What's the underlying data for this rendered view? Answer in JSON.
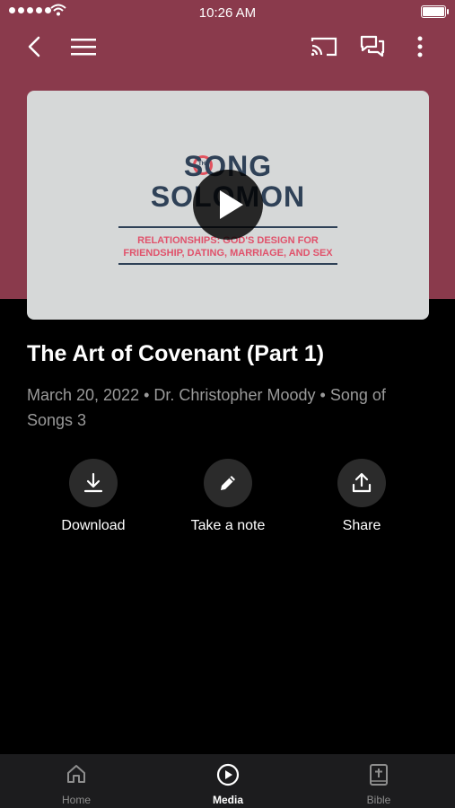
{
  "status_bar": {
    "time": "10:26 AM"
  },
  "media": {
    "artwork": {
      "title_line1": "SONG",
      "title_line2": "SOLOMON",
      "the_label": "THE",
      "subtitle_line1": "RELATIONSHIPS: GOD'S DESIGN FOR",
      "subtitle_line2": "FRIENDSHIP, DATING, MARRIAGE, AND SEX"
    },
    "title": "The Art of Covenant (Part 1)",
    "date": "March 20, 2022",
    "speaker": "Dr. Christopher Moody",
    "series": "Song of Songs 3"
  },
  "actions": [
    {
      "label": "Download",
      "icon": "download-icon"
    },
    {
      "label": "Take a note",
      "icon": "pencil-icon"
    },
    {
      "label": "Share",
      "icon": "share-icon"
    }
  ],
  "tabs": [
    {
      "label": "Home",
      "icon": "home-icon"
    },
    {
      "label": "Media",
      "icon": "play-circle-icon"
    },
    {
      "label": "Bible",
      "icon": "bible-icon"
    }
  ],
  "colors": {
    "header": "#8a3a4c",
    "background": "#000000",
    "tabbar": "#1c1c1e",
    "accent_red": "#e0526b",
    "navy": "#2f4157"
  }
}
